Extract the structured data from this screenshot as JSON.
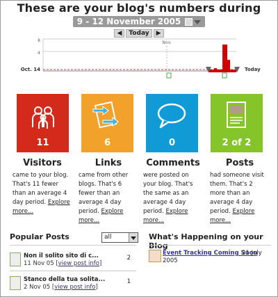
{
  "header": {
    "title": "These are your blog's numbers during",
    "date_range": "9 - 12 November 2005",
    "nav_today": "Today",
    "nav_prev": "◀",
    "nav_next": "▶"
  },
  "timeline": {
    "left_label": "Oct. 14",
    "right_label": "Today",
    "month_label": "Nov.",
    "y_labels": [
      "8",
      "4"
    ]
  },
  "tiles": [
    {
      "id": "visitors",
      "value": "11",
      "color": "#d42a1c",
      "icon": "people-icon"
    },
    {
      "id": "links",
      "value": "6",
      "color": "#f2a12a",
      "icon": "links-icon"
    },
    {
      "id": "comments",
      "value": "0",
      "color": "#119bd6",
      "icon": "speech-bubble-icon"
    },
    {
      "id": "posts",
      "value": "2 of 2",
      "color": "#86c52a",
      "icon": "document-icon"
    }
  ],
  "stats": [
    {
      "title": "Visitors",
      "text": "came to your blog. That's 11 fewer than an average 4 day period.",
      "link": "Explore more..."
    },
    {
      "title": "Links",
      "text": "came from other blogs. That's 6 fewer than an average 4 day period.",
      "link": "Explore more..."
    },
    {
      "title": "Comments",
      "text": "were posted on your blog. That's the same as an average 4 day period.",
      "link": "Explore more..."
    },
    {
      "title": "Posts",
      "text": "had someone visit them. That's 2 more than an average 4 day period.",
      "link": "Explore more..."
    }
  ],
  "popular": {
    "title": "Popular Posts",
    "filter_value": "all",
    "items": [
      {
        "title": "Non il solito sito di c...",
        "date": "11 Nov 05",
        "link": "view post info",
        "count": "2"
      },
      {
        "title": "Stanco della tua solita...",
        "date": "2 Nov 05",
        "link": "view post info",
        "count": "1"
      }
    ]
  },
  "happening": {
    "title": "What's Happening on your Blog",
    "items": [
      {
        "title": "Event Tracking Coming Soon",
        "date": "21 July",
        "year": "2005"
      }
    ]
  }
}
